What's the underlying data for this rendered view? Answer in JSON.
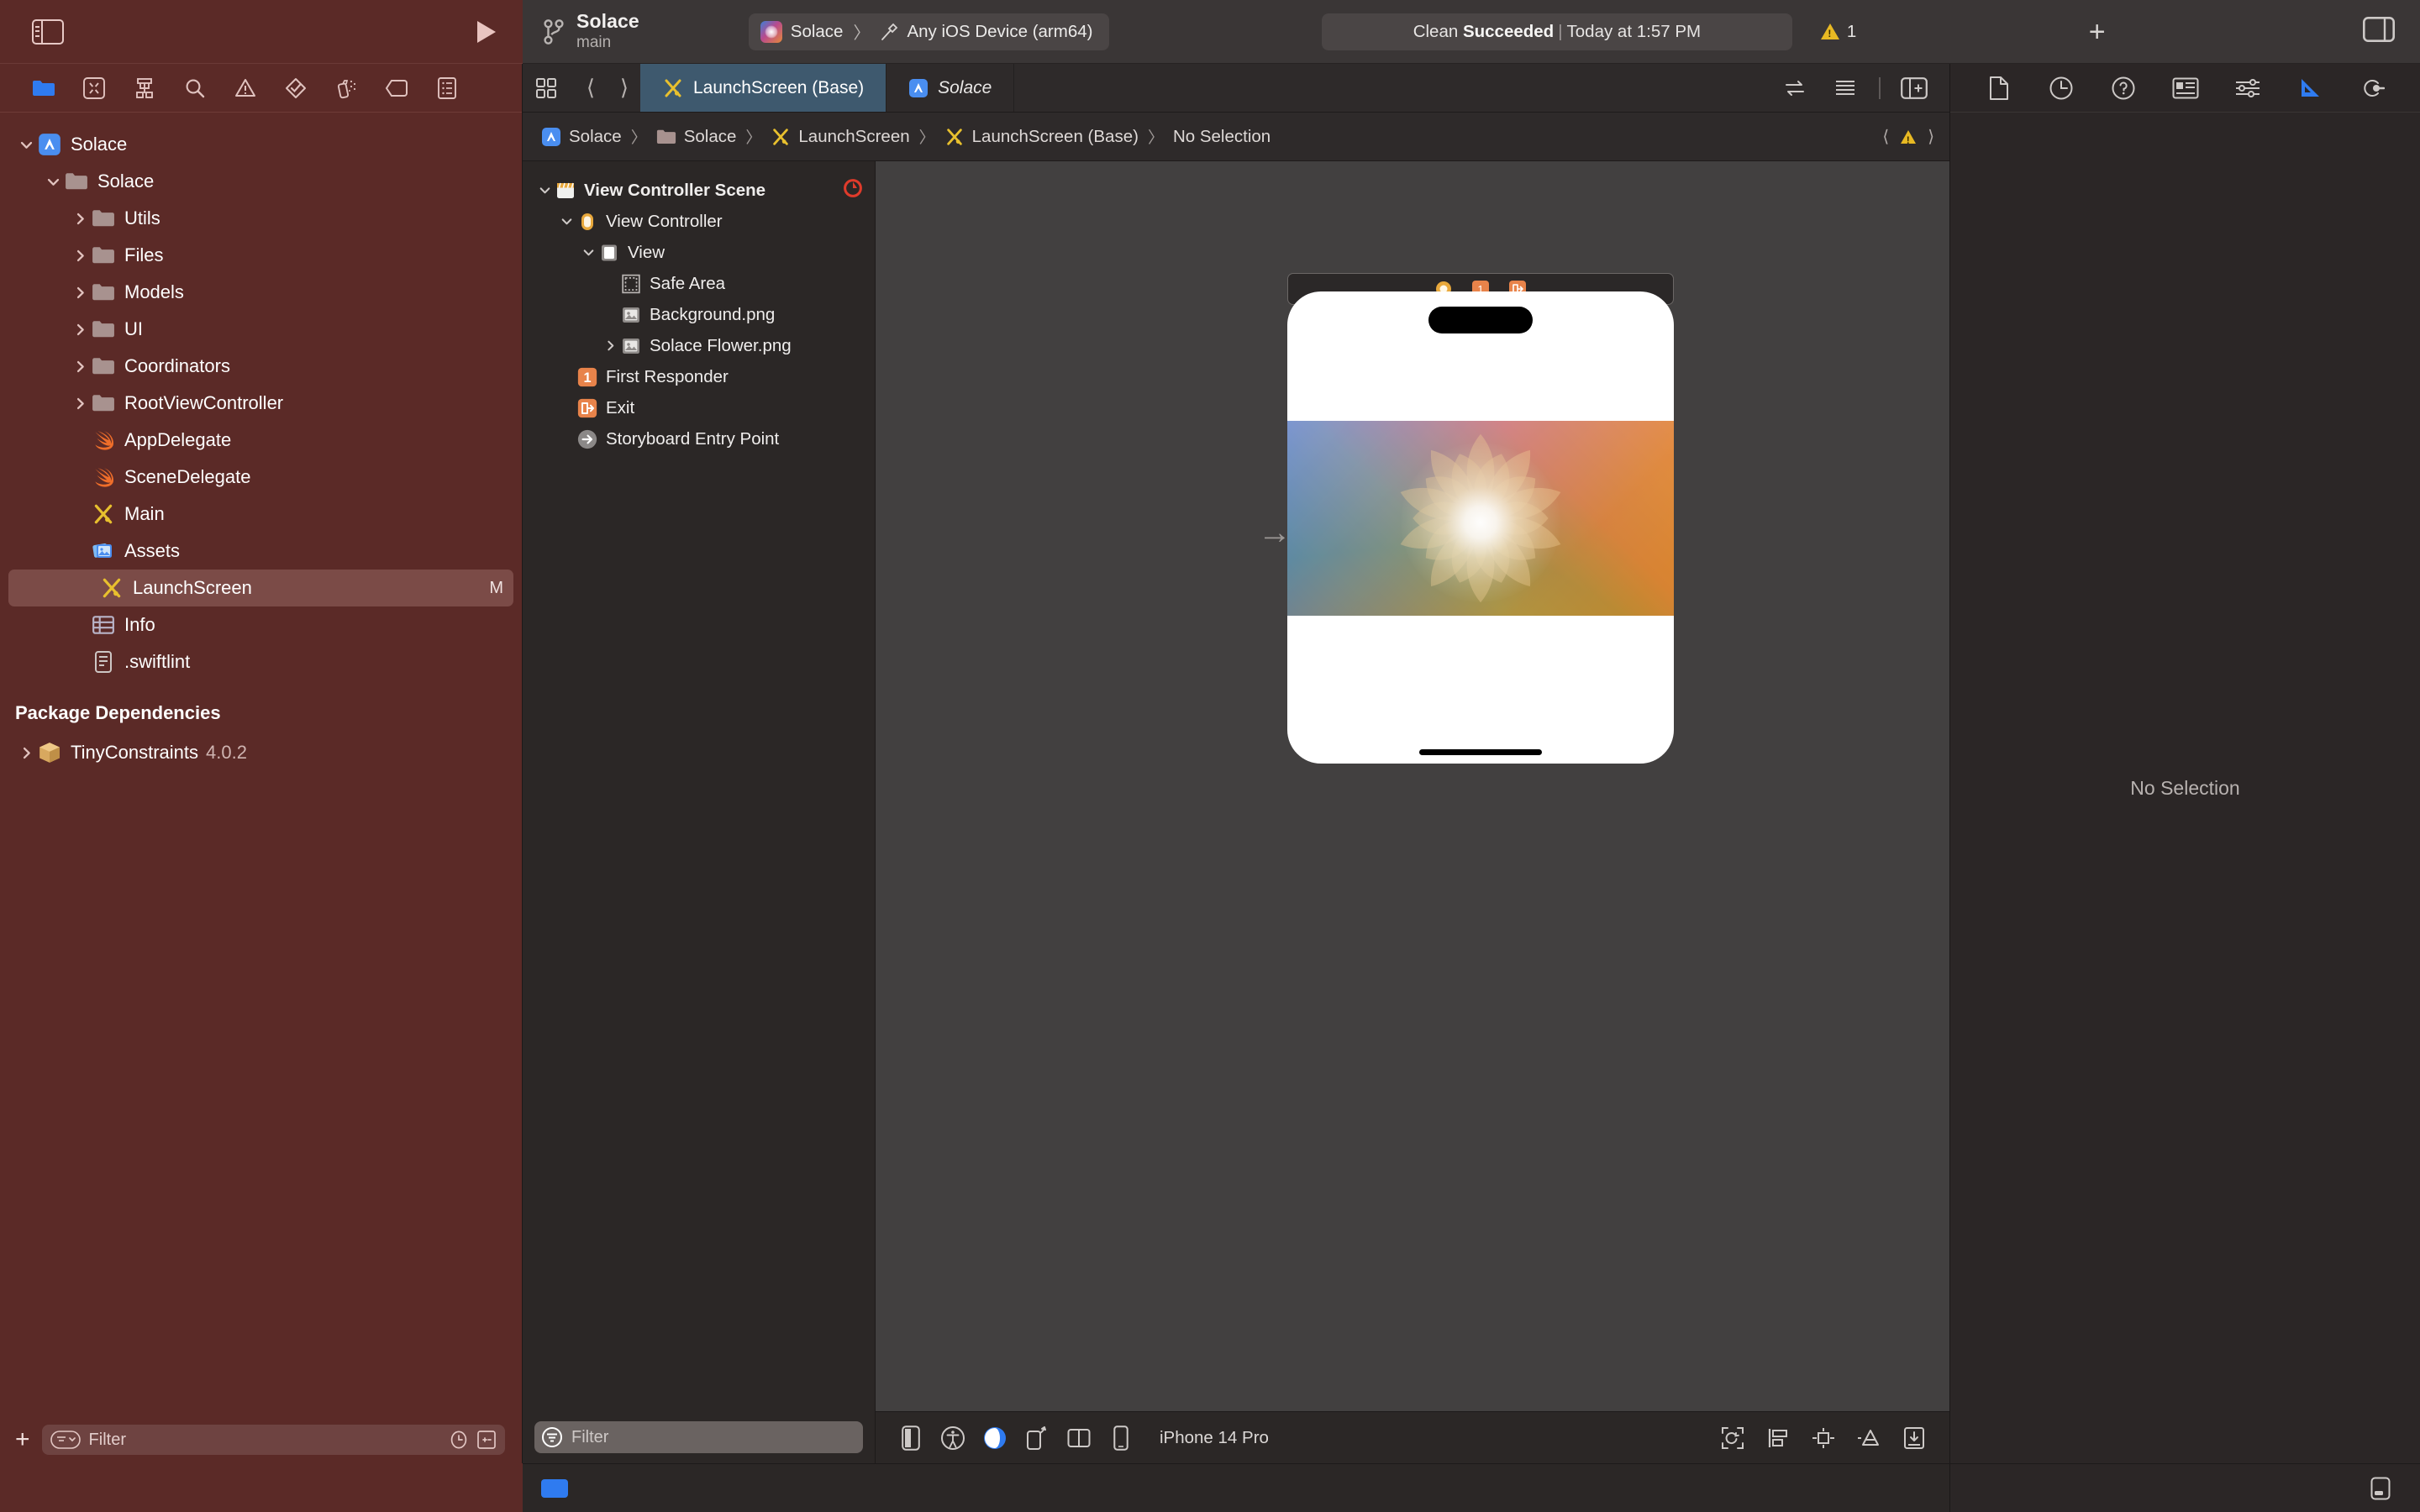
{
  "toolbar": {
    "sidebar_toggle_icon": "sidebar-left-icon",
    "run_button_icon": "play-icon",
    "branch_icon": "source-control-branch-icon",
    "scheme_name": "Solace",
    "branch_name": "main",
    "destination": {
      "app_icon": "solace-app-icon",
      "scheme": "Solace",
      "separator": "〉",
      "hammer_icon": "build-hammer-icon",
      "device": "Any iOS Device (arm64)"
    },
    "status": {
      "prefix": "Clean",
      "result": "Succeeded",
      "separator": "|",
      "time": "Today at 1:57 PM"
    },
    "warning_icon": "warning-triangle-icon",
    "warning_count": "1",
    "add_button_icon": "plus-icon",
    "inspector_toggle_icon": "sidebar-right-icon"
  },
  "navigator": {
    "tabs": [
      {
        "icon": "folder-project-navigator-icon",
        "name": "project-navigator",
        "active": true
      },
      {
        "icon": "source-control-navigator-icon",
        "name": "source-control-navigator",
        "active": false
      },
      {
        "icon": "hierarchy-navigator-icon",
        "name": "hierarchy-navigator",
        "active": false
      },
      {
        "icon": "search-navigator-icon",
        "name": "find-navigator",
        "active": false
      },
      {
        "icon": "warning-triangle-navigator-icon",
        "name": "issue-navigator",
        "active": false
      },
      {
        "icon": "test-diamond-navigator-icon",
        "name": "test-navigator",
        "active": false
      },
      {
        "icon": "debug-spray-navigator-icon",
        "name": "debug-navigator",
        "active": false
      },
      {
        "icon": "breakpoint-tag-navigator-icon",
        "name": "breakpoint-navigator",
        "active": false
      },
      {
        "icon": "report-list-navigator-icon",
        "name": "report-navigator",
        "active": false
      }
    ],
    "tree": [
      {
        "label": "Solace",
        "icon": "xcode-project-icon",
        "depth": 0,
        "twisty": "down",
        "badge": ""
      },
      {
        "label": "Solace",
        "icon": "folder-icon",
        "depth": 1,
        "twisty": "down",
        "badge": ""
      },
      {
        "label": "Utils",
        "icon": "folder-icon",
        "depth": 2,
        "twisty": "right",
        "badge": ""
      },
      {
        "label": "Files",
        "icon": "folder-icon",
        "depth": 2,
        "twisty": "right",
        "badge": ""
      },
      {
        "label": "Models",
        "icon": "folder-icon",
        "depth": 2,
        "twisty": "right",
        "badge": ""
      },
      {
        "label": "UI",
        "icon": "folder-icon",
        "depth": 2,
        "twisty": "right",
        "badge": ""
      },
      {
        "label": "Coordinators",
        "icon": "folder-icon",
        "depth": 2,
        "twisty": "right",
        "badge": ""
      },
      {
        "label": "RootViewController",
        "icon": "folder-icon",
        "depth": 2,
        "twisty": "right",
        "badge": ""
      },
      {
        "label": "AppDelegate",
        "icon": "swift-file-icon",
        "depth": 2,
        "twisty": "",
        "badge": ""
      },
      {
        "label": "SceneDelegate",
        "icon": "swift-file-icon",
        "depth": 2,
        "twisty": "",
        "badge": ""
      },
      {
        "label": "Main",
        "icon": "storyboard-icon",
        "depth": 2,
        "twisty": "",
        "badge": ""
      },
      {
        "label": "Assets",
        "icon": "assets-catalog-icon",
        "depth": 2,
        "twisty": "",
        "badge": ""
      },
      {
        "label": "LaunchScreen",
        "icon": "storyboard-icon",
        "depth": 2,
        "twisty": "",
        "badge": "M",
        "selected": true
      },
      {
        "label": "Info",
        "icon": "plist-icon",
        "depth": 2,
        "twisty": "",
        "badge": ""
      },
      {
        "label": ".swiftlint",
        "icon": "text-file-icon",
        "depth": 2,
        "twisty": "",
        "badge": ""
      }
    ],
    "section_header": "Package Dependencies",
    "packages": [
      {
        "label": "TinyConstraints",
        "version": "4.0.2",
        "icon": "swift-package-icon",
        "twisty": "right"
      }
    ],
    "filter": {
      "placeholder": "Filter",
      "add_icon": "plus-icon",
      "scope_icon": "filter-scope-icon",
      "recent_icon": "recent-clock-icon",
      "sourcecontrol_icon": "source-control-filter-icon"
    }
  },
  "editor": {
    "grid_icon": "editor-grid-icon",
    "back_icon": "chevron-left-icon",
    "forward_icon": "chevron-right-icon",
    "tabs": [
      {
        "label": "LaunchScreen (Base)",
        "icon": "storyboard-icon",
        "active": true,
        "italic": false
      },
      {
        "label": "Solace",
        "icon": "xcode-project-icon",
        "active": false,
        "italic": true
      }
    ],
    "right_icons": [
      {
        "icon": "code-review-arrows-icon",
        "name": "adjust-editor-options"
      },
      {
        "icon": "lines-list-icon",
        "name": "minimap-toggle"
      },
      {
        "icon": "add-editor-icon",
        "name": "add-editor"
      }
    ],
    "breadcrumb": [
      {
        "label": "Solace",
        "icon": "xcode-project-icon"
      },
      {
        "label": "Solace",
        "icon": "folder-icon"
      },
      {
        "label": "LaunchScreen",
        "icon": "storyboard-icon"
      },
      {
        "label": "LaunchScreen (Base)",
        "icon": "storyboard-icon"
      },
      {
        "label": "No Selection",
        "icon": ""
      }
    ],
    "breadcrumb_right": {
      "prev_icon": "chevron-left-icon",
      "warning_icon": "warning-triangle-icon",
      "next_icon": "chevron-right-icon"
    }
  },
  "outline": {
    "items": [
      {
        "label": "View Controller Scene",
        "icon": "scene-icon",
        "depth": 0,
        "twisty": "down",
        "bold": true,
        "badge_icon": "entry-point-red-icon"
      },
      {
        "label": "View Controller",
        "icon": "view-controller-icon",
        "depth": 1,
        "twisty": "down",
        "bold": false,
        "badge_icon": ""
      },
      {
        "label": "View",
        "icon": "view-icon",
        "depth": 2,
        "twisty": "down",
        "bold": false,
        "badge_icon": ""
      },
      {
        "label": "Safe Area",
        "icon": "safe-area-icon",
        "depth": 3,
        "twisty": "",
        "bold": false,
        "badge_icon": ""
      },
      {
        "label": "Background.png",
        "icon": "image-view-icon",
        "depth": 3,
        "twisty": "",
        "bold": false,
        "badge_icon": ""
      },
      {
        "label": "Solace Flower.png",
        "icon": "image-view-icon",
        "depth": 3,
        "twisty": "right",
        "bold": false,
        "badge_icon": ""
      },
      {
        "label": "First Responder",
        "icon": "first-responder-icon",
        "depth": 1,
        "twisty": "",
        "bold": false,
        "badge_icon": ""
      },
      {
        "label": "Exit",
        "icon": "exit-icon",
        "depth": 1,
        "twisty": "",
        "bold": false,
        "badge_icon": ""
      },
      {
        "label": "Storyboard Entry Point",
        "icon": "storyboard-entry-point-icon",
        "depth": 1,
        "twisty": "",
        "bold": false,
        "badge_icon": ""
      }
    ],
    "filter": {
      "placeholder": "Filter",
      "icon": "filter-circle-icon"
    }
  },
  "canvas": {
    "scene_dock_icons": [
      {
        "icon": "view-controller-dock-icon",
        "name": "scene-dock-view-controller"
      },
      {
        "icon": "first-responder-dock-icon",
        "name": "scene-dock-first-responder"
      },
      {
        "icon": "exit-dock-icon",
        "name": "scene-dock-exit"
      }
    ],
    "entry_arrow_icon": "storyboard-entry-arrow-icon",
    "device_label": "iPhone 14 Pro",
    "bottom_left_icons": [
      {
        "icon": "device-orientation-icon",
        "name": "device-variant-button"
      },
      {
        "icon": "accessibility-icon",
        "name": "accessibility-button"
      },
      {
        "icon": "appearance-contrast-icon",
        "name": "appearance-button",
        "active": true
      },
      {
        "icon": "rotate-device-icon",
        "name": "orientation-button"
      },
      {
        "icon": "split-view-icon",
        "name": "split-view-button"
      },
      {
        "icon": "device-phone-icon",
        "name": "device-picker-button"
      }
    ],
    "bottom_right_icons": [
      {
        "icon": "zoom-fit-icon",
        "name": "zoom-to-fit-button"
      },
      {
        "icon": "align-icon",
        "name": "align-button"
      },
      {
        "icon": "embed-icon",
        "name": "embed-button"
      },
      {
        "icon": "resolve-auto-layout-icon",
        "name": "resolve-auto-layout-button"
      },
      {
        "icon": "add-constraints-icon",
        "name": "add-constraints-button"
      }
    ]
  },
  "inspector": {
    "tabs": [
      {
        "icon": "file-inspector-icon",
        "name": "file-inspector-tab",
        "active": false
      },
      {
        "icon": "history-inspector-icon",
        "name": "history-inspector-tab",
        "active": false
      },
      {
        "icon": "quick-help-inspector-icon",
        "name": "quick-help-inspector-tab",
        "active": false
      },
      {
        "icon": "identity-inspector-icon",
        "name": "identity-inspector-tab",
        "active": false
      },
      {
        "icon": "attributes-inspector-icon",
        "name": "attributes-inspector-tab",
        "active": false
      },
      {
        "icon": "size-inspector-icon",
        "name": "size-inspector-tab",
        "active": true
      },
      {
        "icon": "connections-inspector-icon",
        "name": "connections-inspector-tab",
        "active": false
      }
    ],
    "empty_message": "No Selection"
  },
  "statusbar": {
    "activity_icon": "activity-blue-icon",
    "console_toggle_icon": "console-toggle-icon"
  },
  "colors": {
    "accent_blue": "#2f7bf0",
    "navigator_bg": "#5b2a27",
    "selected_row": "#7b4b47",
    "active_tab": "#3e596e",
    "canvas_bg": "#424040",
    "panel_bg": "#2b2726",
    "warning_yellow": "#e8b923",
    "storyboard_yellow": "#e8c02e",
    "swift_orange": "#ef6e2a",
    "entry_red": "#e03b2b"
  }
}
